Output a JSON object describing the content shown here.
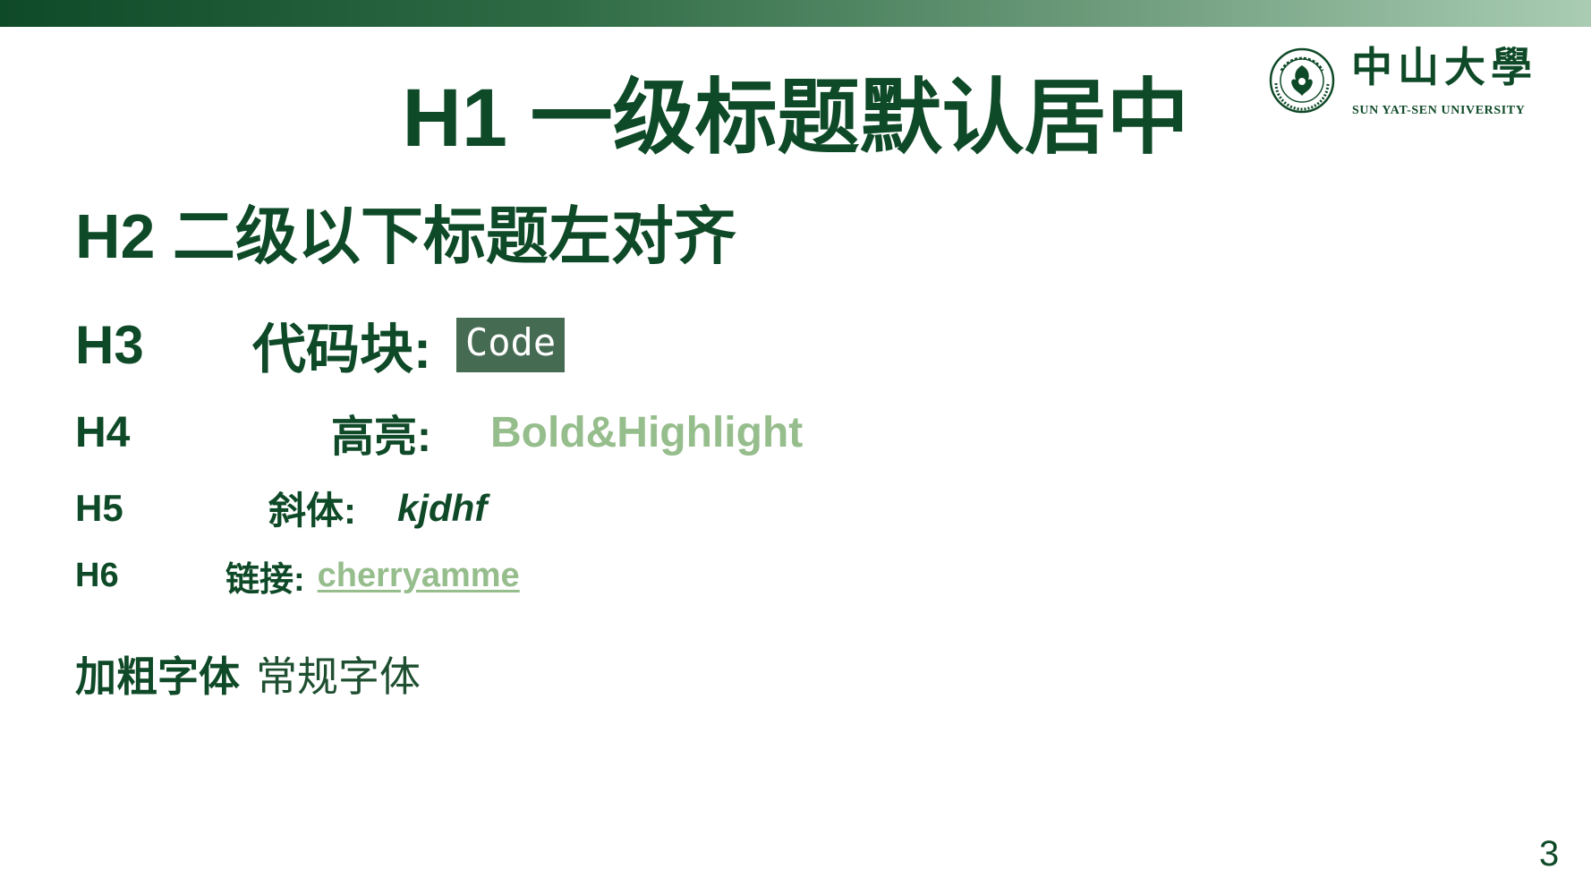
{
  "logo": {
    "cn_name": "中山大學",
    "en_name": "SUN  YAT-SEN UNIVERSITY",
    "seal_cn": "中山大學",
    "seal_en": "SUN YAT-SEN UNIVERSITY"
  },
  "h1": "H1 一级标题默认居中",
  "h2": "H2 二级以下标题左对齐",
  "h3": {
    "tag": "H3",
    "label": "代码块:",
    "code": "Code"
  },
  "h4": {
    "tag": "H4",
    "label": "高亮:",
    "highlight": "Bold&Highlight"
  },
  "h5": {
    "tag": "H5",
    "label": "斜体:",
    "italic": "kjdhf"
  },
  "h6": {
    "tag": "H6",
    "label": "链接:",
    "link": "cherryamme"
  },
  "body": {
    "bold": "加粗字体",
    "regular": "常规字体"
  },
  "page_number": "3",
  "colors": {
    "primary": "#0f4a28",
    "highlight": "#96bd8c",
    "code_bg": "#466b53"
  }
}
